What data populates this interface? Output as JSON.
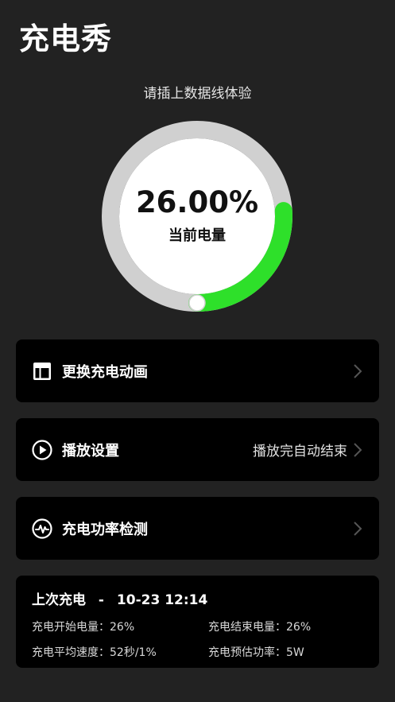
{
  "app": {
    "title": "充电秀"
  },
  "hint": "请插上数据线体验",
  "gauge": {
    "percent_text": "26.00%",
    "percent_value": 26,
    "label": "当前电量",
    "track_color": "#d0d0d0",
    "progress_color": "#2ee02a"
  },
  "menu": [
    {
      "label": "更换充电动画",
      "value": "",
      "icon": "layout-icon"
    },
    {
      "label": "播放设置",
      "value": "播放完自动结束",
      "icon": "play-circle-icon"
    },
    {
      "label": "充电功率检测",
      "value": "",
      "icon": "pulse-icon"
    }
  ],
  "history": {
    "title_prefix": "上次充电",
    "separator": "-",
    "datetime": "10-23 12:14",
    "start_level": "充电开始电量：26%",
    "end_level": "充电结束电量：26%",
    "avg_speed": "充电平均速度：52秒/1%",
    "est_power": "充电预估功率：5W"
  }
}
